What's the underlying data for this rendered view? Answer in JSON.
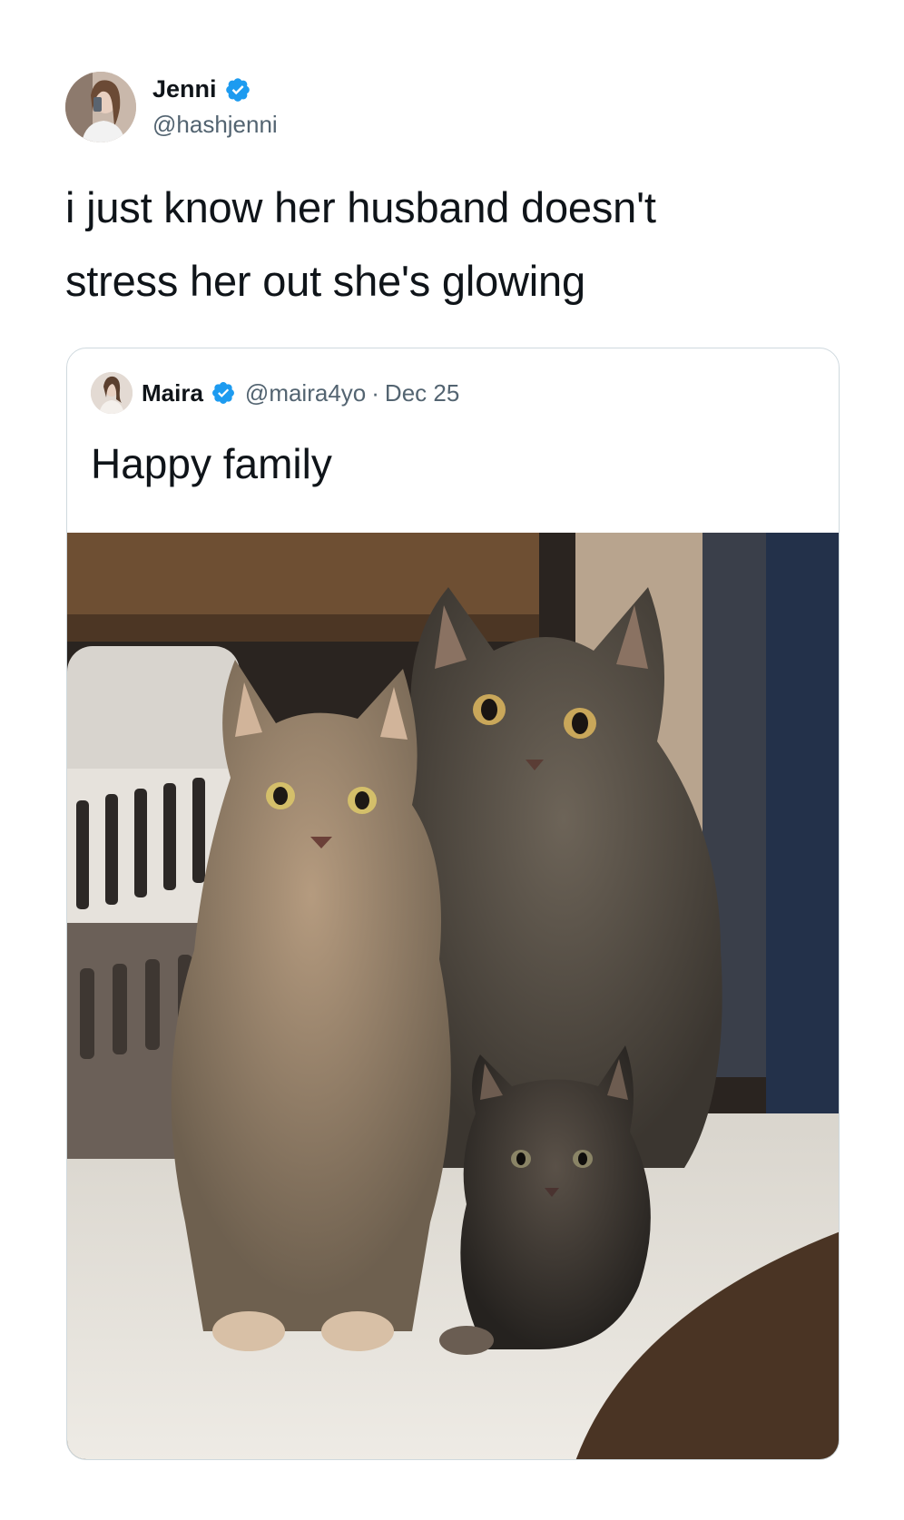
{
  "tweet": {
    "author": {
      "name": "Jenni",
      "handle": "@hashjenni",
      "avatar_icon": "person-avatar",
      "verified_icon": "verified-badge-icon"
    },
    "text_lines": [
      "i just know her husband doesn't",
      "stress her out she's glowing"
    ]
  },
  "quote": {
    "author": {
      "name": "Maira",
      "handle": "@maira4yo",
      "separator": "·",
      "date": "Dec 25",
      "avatar_icon": "person-avatar",
      "verified_icon": "verified-badge-icon"
    },
    "text": "Happy family",
    "image_icon": "cat-family-photo"
  },
  "colors": {
    "text": "#0f1419",
    "secondary_text": "#536471",
    "verified_blue": "#1d9bf0",
    "card_border": "#cfd9de"
  }
}
